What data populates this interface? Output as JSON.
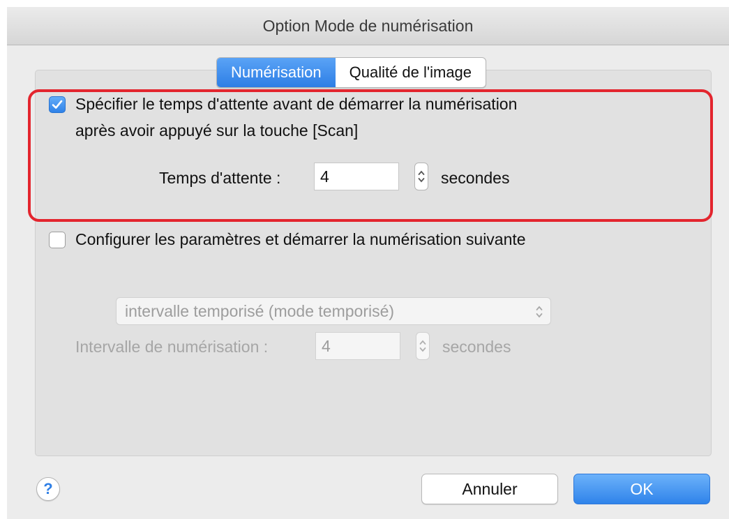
{
  "window": {
    "title": "Option Mode de numérisation"
  },
  "tabs": [
    {
      "label": "Numérisation",
      "active": true
    },
    {
      "label": "Qualité de l'image",
      "active": false
    }
  ],
  "wait_option": {
    "checked": true,
    "label_line1": "Spécifier le temps d'attente avant de démarrer la numérisation",
    "label_line2": "après avoir appuyé sur la touche [Scan]",
    "wait_label": "Temps d'attente :",
    "wait_value": "4",
    "unit": "secondes"
  },
  "continuous_option": {
    "checked": false,
    "label": "Configurer les paramètres et démarrer la numérisation suivante",
    "mode_select": "intervalle temporisé (mode temporisé)",
    "interval_label": "Intervalle de numérisation :",
    "interval_value": "4",
    "unit": "secondes"
  },
  "buttons": {
    "help": "?",
    "cancel": "Annuler",
    "ok": "OK"
  },
  "colors": {
    "accent": "#2d7ee5",
    "highlight": "#e3252e",
    "disabled_text": "#a6a6a6"
  }
}
